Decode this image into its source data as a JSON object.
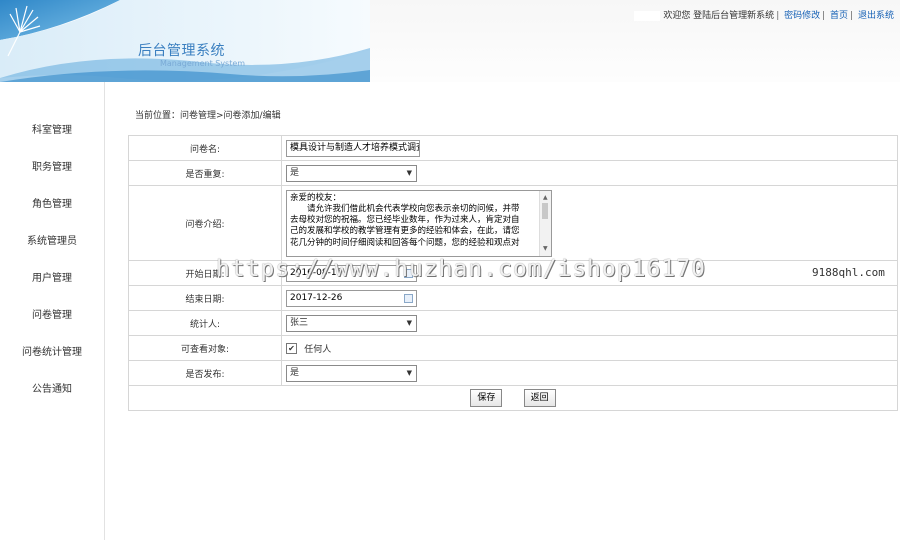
{
  "header": {
    "title": "后台管理系统",
    "subtitle": "Management System",
    "welcome": "欢迎您 登陆后台管理新系统",
    "links": [
      "密码修改",
      "首页",
      "退出系统"
    ]
  },
  "sidebar": {
    "items": [
      "科室管理",
      "职务管理",
      "角色管理",
      "系统管理员",
      "用户管理",
      "问卷管理",
      "问卷统计管理",
      "公告通知"
    ]
  },
  "breadcrumb": "当前位置：问卷管理>问卷添加/编辑",
  "form": {
    "name_label": "问卷名:",
    "name_value": "模具设计与制造人才培养模式调查",
    "repeat_label": "是否重复:",
    "repeat_value": "是",
    "intro_label": "问卷介绍:",
    "intro_lines": [
      "亲爱的校友：",
      "　　请允许我们借此机会代表学校向您表示亲切的问候，并带",
      "去母校对您的祝福。您已经毕业数年，作为过来人，肯定对自",
      "己的发展和学校的教学管理有更多的经验和体会，在此，请您",
      "花几分钟的时间仔细阅读和回答每个问题，您的经验和观点对"
    ],
    "start_label": "开始日期:",
    "start_value": "2016-08-15",
    "end_label": "结束日期:",
    "end_value": "2017-12-26",
    "stat_label": "统计人:",
    "stat_value": "张三",
    "visible_label": "可查看对象:",
    "visible_option": "任何人",
    "publish_label": "是否发布:",
    "publish_value": "是",
    "save_label": "保存",
    "back_label": "返回"
  },
  "watermark": {
    "url": "https://www.huzhan.com/ishop16170",
    "site": "9188qhl.com"
  },
  "colors": {
    "accent": "#3a7fc0",
    "link": "#1560b5",
    "border": "#d6d6d6"
  }
}
